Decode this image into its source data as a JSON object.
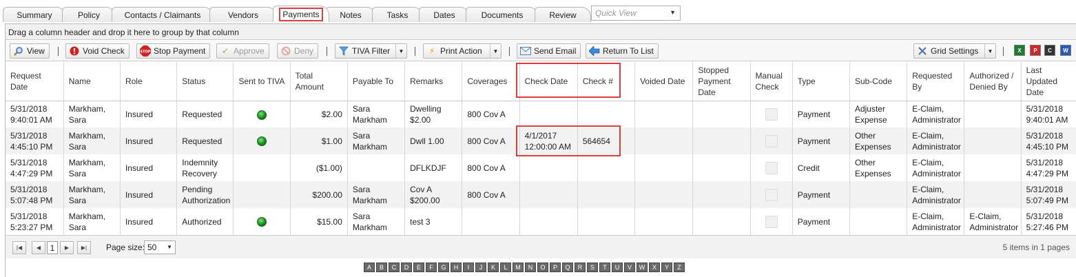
{
  "tabs": [
    "Summary",
    "Policy",
    "Contacts / Claimants",
    "Vendors",
    "Payments",
    "Notes",
    "Tasks",
    "Dates",
    "Documents",
    "Review"
  ],
  "quick_view_placeholder": "Quick View",
  "group_panel_text": "Drag a column header and drop it here to group by that column",
  "toolbar": {
    "view": "View",
    "void_check": "Void Check",
    "stop_payment": "Stop Payment",
    "approve": "Approve",
    "deny": "Deny",
    "tiva_filter": "TIVA Filter",
    "print_action": "Print Action",
    "send_email": "Send Email",
    "return_to_list": "Return To List",
    "grid_settings": "Grid Settings"
  },
  "columns": [
    "Request Date",
    "Name",
    "Role",
    "Status",
    "Sent to TIVA",
    "Total Amount",
    "Payable To",
    "Remarks",
    "Coverages",
    "Check Date",
    "Check #",
    "Voided Date",
    "Stopped Payment Date",
    "Manual Check",
    "Type",
    "Sub-Code",
    "Requested By",
    "Authorized / Denied By",
    "Last Updated Date"
  ],
  "rows": [
    {
      "request_date": "5/31/2018 9:40:01 AM",
      "name": "Markham, Sara",
      "role": "Insured",
      "status": "Requested",
      "sent_to_tiva": true,
      "total": "$2.00",
      "payable_to": "Sara Markham",
      "remarks": "Dwelling $2.00",
      "coverages": "800 Cov A",
      "check_date": "",
      "check_no": "",
      "voided": "",
      "stopped": "",
      "type": "Payment",
      "sub_code": "Adjuster Expense",
      "requested_by": "E-Claim, Administrator",
      "authorized_by": "",
      "last_updated": "5/31/2018 9:40:01 AM"
    },
    {
      "request_date": "5/31/2018 4:45:10 PM",
      "name": "Markham, Sara",
      "role": "Insured",
      "status": "Requested",
      "sent_to_tiva": true,
      "total": "$1.00",
      "payable_to": "Sara Markham",
      "remarks": "Dwll 1.00",
      "coverages": "800 Cov A",
      "check_date": "4/1/2017 12:00:00 AM",
      "check_no": "564654",
      "voided": "",
      "stopped": "",
      "type": "Payment",
      "sub_code": "Other Expenses",
      "requested_by": "E-Claim, Administrator",
      "authorized_by": "",
      "last_updated": "5/31/2018 4:45:10 PM"
    },
    {
      "request_date": "5/31/2018 4:47:29 PM",
      "name": "Markham, Sara",
      "role": "Insured",
      "status": "Indemnity Recovery",
      "sent_to_tiva": false,
      "total": "($1.00)",
      "payable_to": "",
      "remarks": "DFLKDJF",
      "coverages": "800 Cov A",
      "check_date": "",
      "check_no": "",
      "voided": "",
      "stopped": "",
      "type": "Credit",
      "sub_code": "Other Expenses",
      "requested_by": "E-Claim, Administrator",
      "authorized_by": "",
      "last_updated": "5/31/2018 4:47:29 PM"
    },
    {
      "request_date": "5/31/2018 5:07:48 PM",
      "name": "Markham, Sara",
      "role": "Insured",
      "status": "Pending Authorization",
      "sent_to_tiva": false,
      "total": "$200.00",
      "payable_to": "Sara Markham",
      "remarks": "Cov A $200.00",
      "coverages": "800 Cov A",
      "check_date": "",
      "check_no": "",
      "voided": "",
      "stopped": "",
      "type": "Payment",
      "sub_code": "",
      "requested_by": "E-Claim, Administrator",
      "authorized_by": "",
      "last_updated": "5/31/2018 5:07:49 PM"
    },
    {
      "request_date": "5/31/2018 5:23:27 PM",
      "name": "Markham, Sara",
      "role": "Insured",
      "status": "Authorized",
      "sent_to_tiva": true,
      "total": "$15.00",
      "payable_to": "Sara Markham",
      "remarks": "test 3",
      "coverages": "",
      "check_date": "",
      "check_no": "",
      "voided": "",
      "stopped": "",
      "type": "Payment",
      "sub_code": "",
      "requested_by": "E-Claim, Administrator",
      "authorized_by": "E-Claim, Administrator",
      "last_updated": "5/31/2018 5:27:46 PM"
    }
  ],
  "pager": {
    "current_page": "1",
    "page_size_label": "Page size:",
    "page_size": "50",
    "info": "5 items in 1 pages"
  },
  "alphabet": [
    "A",
    "B",
    "C",
    "D",
    "E",
    "F",
    "G",
    "H",
    "I",
    "J",
    "K",
    "L",
    "M",
    "N",
    "O",
    "P",
    "Q",
    "R",
    "S",
    "T",
    "U",
    "V",
    "W",
    "X",
    "Y",
    "Z"
  ],
  "colors": {
    "highlight": "#e03c3c",
    "status_dot": "#0c8a0c"
  }
}
